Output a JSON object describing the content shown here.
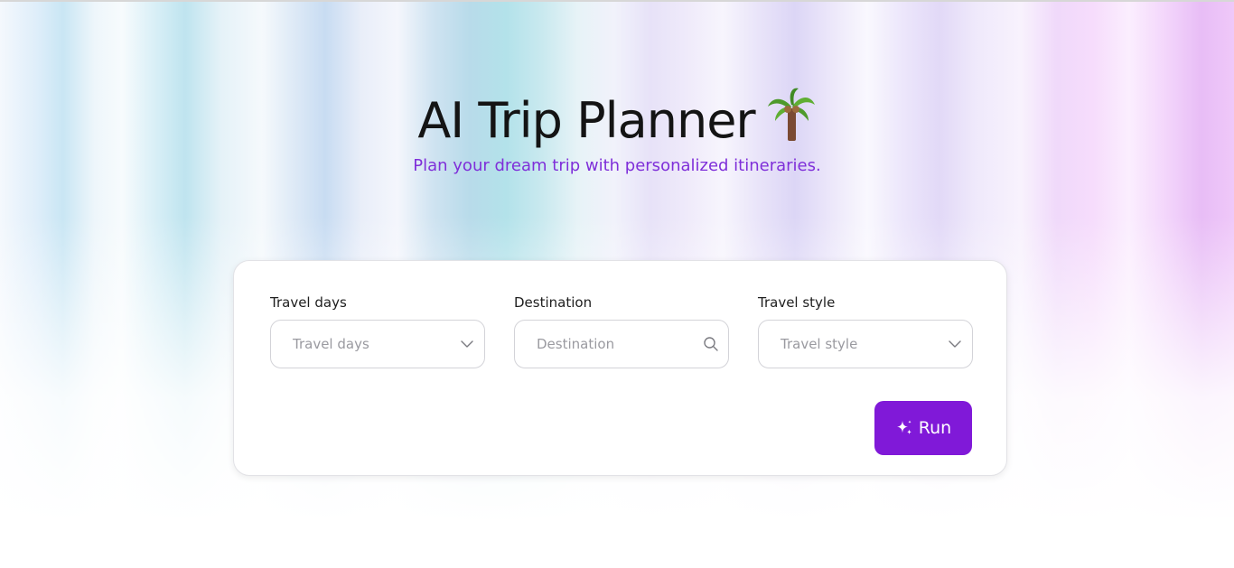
{
  "header": {
    "title": "AI Trip Planner",
    "title_icon": "palm-tree-icon",
    "subtitle": "Plan your dream trip with personalized itineraries."
  },
  "form": {
    "travel_days": {
      "label": "Travel days",
      "placeholder": "Travel days",
      "icon": "chevron-down-icon"
    },
    "destination": {
      "label": "Destination",
      "placeholder": "Destination",
      "icon": "search-icon"
    },
    "travel_style": {
      "label": "Travel style",
      "placeholder": "Travel style",
      "icon": "chevron-down-icon"
    },
    "run_label": "Run",
    "run_icon": "sparkle-icon"
  },
  "colors": {
    "accent": "#8019d8",
    "subtitle": "#7f2fd9",
    "title": "#141414"
  }
}
